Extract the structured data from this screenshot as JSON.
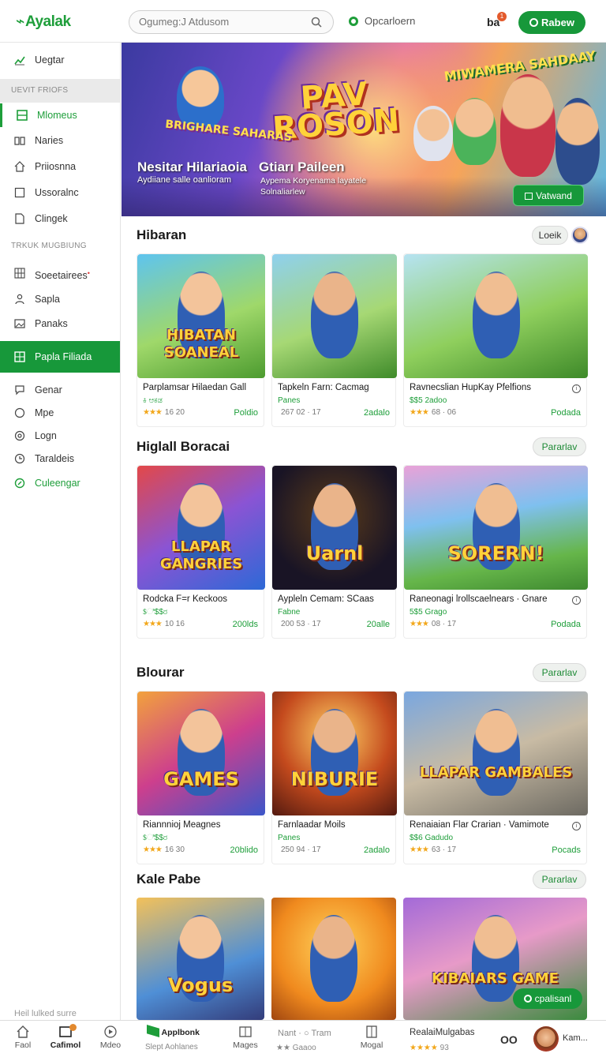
{
  "header": {
    "logo": "Ayalak",
    "search_placeholder": "Ogumeg:J Atdusom",
    "status_label": "Opcarloern",
    "user_short": "ba",
    "notif_count": "1",
    "join_label": "Rabew"
  },
  "sidebar": {
    "top_item": "Uegtar",
    "head1": "UEVIT FRIOFS",
    "items1": [
      "Mlomeus",
      "Naries",
      "Priiosnna",
      "Ussoralnc",
      "Clingek"
    ],
    "head2": "TRKUK MUGBIUNG",
    "items2": [
      "Soeetairees",
      "Sapla",
      "Panaks"
    ],
    "highlight": "Papla Filiada",
    "items3": [
      "Genar",
      "Mpe",
      "Logn",
      "Taraldeis",
      "Culeengar"
    ],
    "footer": "Heil lulked surre"
  },
  "hero": {
    "logo_text_line1": "PAV",
    "logo_text_line2": "ROSON",
    "badge_left": "BRIGHARE SAHARAS",
    "badge_right": "MIWAMERA SAHDAAY",
    "title1": "Nesitar Hilariaoia",
    "subtitle1": "Aydiiane salle oanlioram",
    "title2": "Gtiarı Paileen",
    "subtitle2": "Aypema Koryenama layatele Solnaliarlew",
    "cta": "Vatwand"
  },
  "sections": [
    {
      "title": "Hibaran",
      "button": "Loeik",
      "cards": [
        {
          "title": "Parplamsar Hilaedan Gall",
          "sub": "ಕಿ ಆಕಡ",
          "stars": "★★★",
          "meta": "16  20",
          "action": "Poldio",
          "art": "HIBATAN SOANEAL"
        },
        {
          "title": "Tapkeln Farn: Cacmag",
          "sub": "Panes",
          "stars": "",
          "meta": "267 02 · 17",
          "action": "2adalo",
          "art": ""
        },
        {
          "title": "Ravnecslian HupKay Pfelfions",
          "sub": "$$5 2adoo",
          "stars": "★★★",
          "meta": "68 · 06",
          "action": "Podada",
          "art": ""
        }
      ]
    },
    {
      "title": "Higlall Boracai",
      "button": "Pararlav",
      "cards": [
        {
          "title": "Rodcka F=r Keckoos",
          "sub": "$ಿ$$ರ",
          "stars": "★★★",
          "meta": "10  16",
          "action": "200lds",
          "art": "LLAPAR GANGRIES"
        },
        {
          "title": "Aypleln Cemam: SCaas",
          "sub": "Fabne",
          "stars": "",
          "meta": "200 53 · 17",
          "action": "20alle",
          "art": "Uarnl"
        },
        {
          "title": "Raneonagi lrollscaelnears · Gnare",
          "sub": "5$5 Grago",
          "stars": "★★★",
          "meta": "08 · 17",
          "action": "Podada",
          "art": "SORERN!"
        }
      ]
    },
    {
      "title": "Blourar",
      "button": "Pararlav",
      "cards": [
        {
          "title": "Riannnioj Meagnes",
          "sub": "$ಿ$$ರ",
          "stars": "★★★",
          "meta": "16  30",
          "action": "20blido",
          "art": "GAMES"
        },
        {
          "title": "Farnlaadar Moils",
          "sub": "Panes",
          "stars": "",
          "meta": "250 94 · 17",
          "action": "2adalo",
          "art": "NIBURIE"
        },
        {
          "title": "Renaiaian Flar Crarian  · Vamimote",
          "sub": "$$6 Gadudo",
          "stars": "★★★",
          "meta": "63 · 17",
          "action": "Pocads",
          "art": "LLAPAR GAMBALES"
        }
      ]
    },
    {
      "title": "Kale Pabe",
      "button": "Pararlav",
      "cards": [
        {
          "title": "",
          "sub": "",
          "stars": "",
          "meta": "",
          "action": "",
          "art": "Vogus"
        },
        {
          "title": "",
          "sub": "",
          "stars": "",
          "meta": "",
          "action": "",
          "art": ""
        },
        {
          "title": "",
          "sub": "",
          "stars": "",
          "meta": "",
          "action": "",
          "art": "KIBAIARS GAME"
        }
      ]
    }
  ],
  "float_chip": "cpalisanl",
  "bottom_nav": {
    "items": [
      "Faol",
      "Cafimol",
      "Mdeo",
      "Applbonk",
      "Mages",
      "Mogal"
    ],
    "sub_under_apps": "Slept   Aohlanes",
    "mid_label": "Nant · ○ Tram",
    "mid_meta": "★★ Gaaoo",
    "right_title": "RealaiMulgabas",
    "right_stars": "★★★★",
    "right_meta": "93",
    "oo": "OO",
    "user_name": "Kam..."
  },
  "colors": {
    "brand_green": "#17983a",
    "star": "#f2a71b"
  }
}
